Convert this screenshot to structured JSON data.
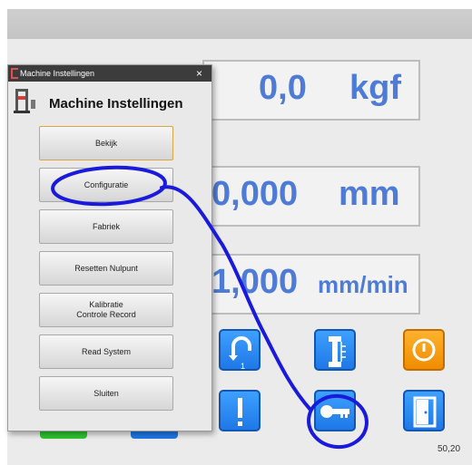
{
  "dialog": {
    "window_title": "Machine Instellingen",
    "close_glyph": "×",
    "header_title": "Machine Instellingen",
    "buttons": {
      "bekijk": "Bekijk",
      "configuratie": "Configuratie",
      "fabriek": "Fabriek",
      "resetten": "Resetten Nulpunt",
      "kalibratie_line1": "Kalibratie",
      "kalibratie_line2": "Controle Record",
      "read_system": "Read System",
      "sluiten": "Sluiten"
    }
  },
  "readouts": {
    "force": {
      "value": "0,0",
      "unit": "kgf"
    },
    "position": {
      "value": "0,000",
      "unit": "mm"
    },
    "speed": {
      "value": "1,000",
      "unit": "mm/min"
    }
  },
  "toolbar_icons": [
    "return-to-position-icon",
    "specimen-icon",
    "power-icon",
    "alert-icon",
    "key-icon",
    "exit-door-icon"
  ],
  "footer": {
    "version": "50,20"
  },
  "colors": {
    "readout_text": "#4e7bd6",
    "tile_blue": "#1e78e6",
    "tile_orange": "#f08c00",
    "annotation_ink": "#1a1adc"
  }
}
